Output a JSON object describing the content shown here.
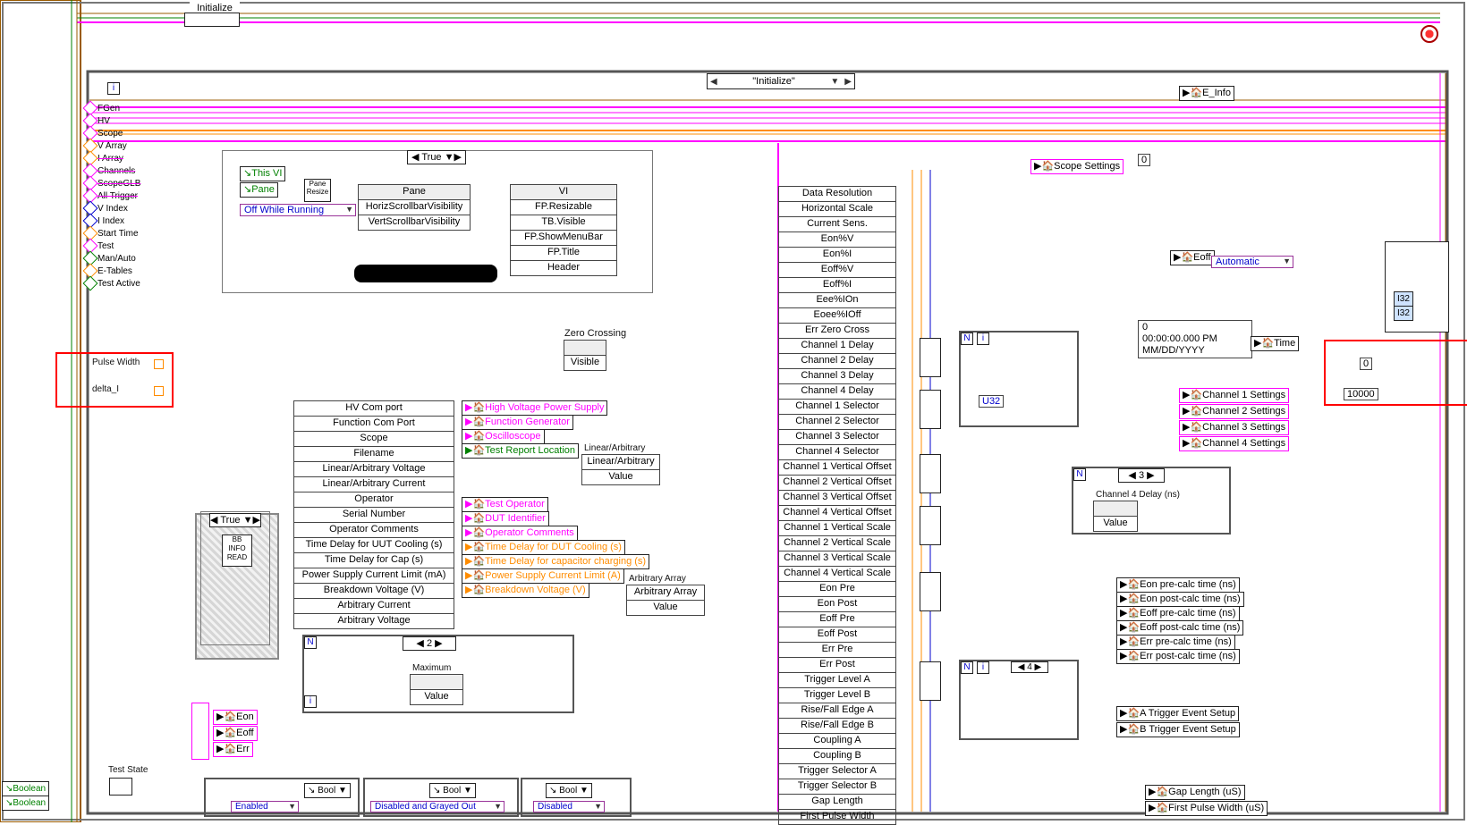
{
  "header": {
    "initialize_caption": "Initialize",
    "case_selector": "\"Initialize\""
  },
  "global": {
    "e_info": "E_Info"
  },
  "left_shift_registers": [
    {
      "label": "FGen",
      "color": "mag"
    },
    {
      "label": "HV",
      "color": "mag"
    },
    {
      "label": "Scope",
      "color": "mag"
    },
    {
      "label": "V Array",
      "color": "orange"
    },
    {
      "label": "I Array",
      "color": "orange"
    },
    {
      "label": "Channels",
      "color": "mag"
    },
    {
      "label": "ScopeGLB",
      "color": "mag"
    },
    {
      "label": "All Trigger",
      "color": "mag"
    },
    {
      "label": "V Index",
      "color": "blue"
    },
    {
      "label": "I Index",
      "color": "blue"
    },
    {
      "label": "Start Time",
      "color": "orange"
    },
    {
      "label": "Test",
      "color": "mag"
    },
    {
      "label": "Man/Auto",
      "color": "green"
    },
    {
      "label": "E-Tables",
      "color": "orange"
    },
    {
      "label": "Test Active",
      "color": "green"
    }
  ],
  "highlight_fields": {
    "a": "Pulse Width",
    "b": "delta_I"
  },
  "true_case": {
    "selector": "True",
    "this_vi": "This VI",
    "pane": "Pane",
    "off_while_running": "Off While Running",
    "pane_node": "Pane",
    "horiz": "HorizScrollbarVisibility",
    "vert": "VertScrollbarVisibility",
    "vi_node": "VI",
    "fp_resizable": "FP.Resizable",
    "tb_visible": "TB.Visible",
    "fp_showmenubar": "FP.ShowMenuBar",
    "fp_title": "FP.Title",
    "header": "Header",
    "pane_resize": "Pane\nResize"
  },
  "zero_crossing": {
    "label": "Zero Crossing",
    "field": "Visible"
  },
  "config_stack": [
    {
      "t": "HV Com port",
      "c": "magenta"
    },
    {
      "t": "Function Com Port",
      "c": "magenta"
    },
    {
      "t": "Scope",
      "c": "magenta"
    },
    {
      "t": "Filename",
      "c": "green"
    },
    {
      "t": "Linear/Arbitrary Voltage",
      "c": "blue"
    },
    {
      "t": "Linear/Arbitrary Current",
      "c": "blue"
    },
    {
      "t": "Operator",
      "c": "magenta"
    },
    {
      "t": "Serial Number",
      "c": "magenta"
    },
    {
      "t": "Operator Comments",
      "c": "magenta"
    },
    {
      "t": "Time Delay for UUT Cooling (s)",
      "c": "orange"
    },
    {
      "t": "Time Delay for Cap (s)",
      "c": "orange"
    },
    {
      "t": "Power Supply Current Limit (mA)",
      "c": "orange"
    },
    {
      "t": "Breakdown Voltage (V)",
      "c": "orange"
    },
    {
      "t": "Arbitrary Current",
      "c": "orange"
    },
    {
      "t": "Arbitrary Voltage",
      "c": "orange"
    }
  ],
  "config_locals": [
    {
      "t": "High Voltage Power Supply",
      "c": "magenta"
    },
    {
      "t": "Function Generator",
      "c": "magenta"
    },
    {
      "t": "Oscilloscope",
      "c": "magenta"
    },
    {
      "t": "Test Report Location",
      "c": "green"
    },
    {
      "t": "Test Operator",
      "c": "magenta"
    },
    {
      "t": "DUT Identifier",
      "c": "magenta"
    },
    {
      "t": "Operator Comments",
      "c": "magenta"
    },
    {
      "t": "Time Delay for DUT Cooling (s)",
      "c": "orange"
    },
    {
      "t": "Time Delay for capacitor charging (s)",
      "c": "orange"
    },
    {
      "t": "Power Supply Current Limit (A)",
      "c": "orange"
    },
    {
      "t": "Breakdown Voltage (V)",
      "c": "orange"
    }
  ],
  "linear_arbitrary": {
    "title": "Linear/Arbitrary",
    "sub": "Linear/Arbitrary",
    "value": "Value"
  },
  "arbitrary_array": {
    "title": "Arbitrary Array",
    "sub": "Arbitrary Array",
    "value": "Value"
  },
  "maximum_loop": {
    "n": "N",
    "i": "i",
    "sel": "2",
    "title": "Maximum",
    "value": "Value"
  },
  "locals_eonoff": {
    "eon": "Eon",
    "eoff": "Eoff",
    "err": "Err"
  },
  "test_state": {
    "label": "Test State"
  },
  "booleans": {
    "a": "Boolean",
    "b": "Boolean"
  },
  "bottom_loops": {
    "bool_label": "Bool",
    "enabled": "Enabled",
    "disabled_grayed": "Disabled and Grayed Out",
    "disabled": "Disabled"
  },
  "scope_stack": [
    {
      "t": "Data Resolution",
      "c": "orange"
    },
    {
      "t": "Horizontal Scale",
      "c": "orange"
    },
    {
      "t": "Current Sens.",
      "c": "orange"
    },
    {
      "t": "Eon%V",
      "c": "orange"
    },
    {
      "t": "Eon%I",
      "c": "orange"
    },
    {
      "t": "Eoff%V",
      "c": "orange"
    },
    {
      "t": "Eoff%I",
      "c": "orange"
    },
    {
      "t": "Eee%IOn",
      "c": "orange"
    },
    {
      "t": "Eoee%IOff",
      "c": "orange"
    },
    {
      "t": "Err Zero Cross",
      "c": "green"
    },
    {
      "t": "Channel 1 Delay",
      "c": "orange"
    },
    {
      "t": "Channel 2 Delay",
      "c": "orange"
    },
    {
      "t": "Channel 3  Delay",
      "c": "orange"
    },
    {
      "t": "Channel 4 Delay",
      "c": "orange"
    },
    {
      "t": "Channel 1 Selector",
      "c": "blue"
    },
    {
      "t": "Channel 2 Selector",
      "c": "blue"
    },
    {
      "t": "Channel 3 Selector",
      "c": "blue"
    },
    {
      "t": "Channel 4 Selector",
      "c": "blue"
    },
    {
      "t": "Channel 1 Vertical Offset",
      "c": "orange"
    },
    {
      "t": "Channel 2 Vertical Offset",
      "c": "orange"
    },
    {
      "t": "Channel 3 Vertical Offset",
      "c": "orange"
    },
    {
      "t": "Channel 4 Vertical Offset",
      "c": "orange"
    },
    {
      "t": "Channel 1 Vertical Scale",
      "c": "orange"
    },
    {
      "t": "Channel 2 Vertical Scale",
      "c": "orange"
    },
    {
      "t": "Channel 3 Vertical Scale",
      "c": "orange"
    },
    {
      "t": "Channel 4 Vertical Scale",
      "c": "orange"
    },
    {
      "t": "Eon Pre",
      "c": "orange"
    },
    {
      "t": "Eon Post",
      "c": "orange"
    },
    {
      "t": "Eoff Pre",
      "c": "orange"
    },
    {
      "t": "Eoff Post",
      "c": "orange"
    },
    {
      "t": "Err Pre",
      "c": "orange"
    },
    {
      "t": "Err Post",
      "c": "orange"
    },
    {
      "t": "Trigger Level A",
      "c": "orange"
    },
    {
      "t": "Trigger Level B",
      "c": "orange"
    },
    {
      "t": "Rise/Fall Edge A",
      "c": "orange"
    },
    {
      "t": "Rise/Fall Edge B",
      "c": "orange"
    },
    {
      "t": "Coupling A",
      "c": "orange"
    },
    {
      "t": "Coupling B",
      "c": "orange"
    },
    {
      "t": "Trigger Selector A",
      "c": "blue"
    },
    {
      "t": "Trigger Selector B",
      "c": "blue"
    },
    {
      "t": "Gap Length",
      "c": "orange"
    },
    {
      "t": "First Pulse Width",
      "c": "orange"
    }
  ],
  "right_locals": {
    "scope_settings": "Scope Settings",
    "eoff": "Eoff",
    "automatic": "Automatic",
    "time": "Time",
    "ch1": "Channel 1 Settings",
    "ch2": "Channel 2 Settings",
    "ch3": "Channel 3 Settings",
    "ch4": "Channel 4 Settings",
    "channel4delay_title": "Channel 4 Delay (ns)",
    "value": "Value",
    "eon_pre": "Eon pre-calc time (ns)",
    "eon_post": "Eon post-calc time (ns)",
    "eoff_pre": "Eoff pre-calc time (ns)",
    "eoff_post": "Eoff post-calc time (ns)",
    "err_pre": "Err pre-calc time (ns)",
    "err_post": "Err post-calc time (ns)",
    "a_trigger": "A Trigger Event Setup",
    "b_trigger": "B Trigger Event Setup",
    "gap_length": "Gap Length (uS)",
    "first_pulse": "First Pulse Width (uS)"
  },
  "timestamp": {
    "zero": "0",
    "time": "00:00:00.000 PM",
    "date": "MM/DD/YYYY"
  },
  "loop3": {
    "sel": "3",
    "n": "N",
    "i": "i"
  },
  "loop4": {
    "sel": "4",
    "n": "N",
    "i": "i"
  },
  "nums": {
    "zero_a": "0",
    "zero_b": "0",
    "u32": "U32",
    "ten_thousand": "10000",
    "far_zero": "0"
  },
  "far_right": {
    "i32_a": "I32",
    "i32_b": "I32"
  }
}
